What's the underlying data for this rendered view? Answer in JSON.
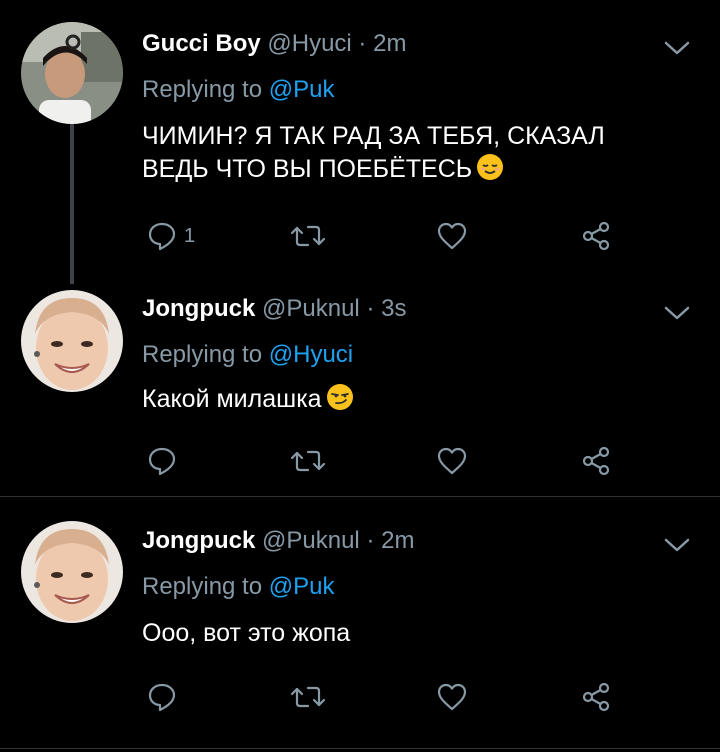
{
  "tweets": [
    {
      "name": "Gucci Boy",
      "handle": "@Hyuci",
      "dot": "·",
      "time": "2m",
      "reply_prefix": "Replying to",
      "reply_to": "@Puk",
      "text_line1": "ЧИМИН? Я ТАК РАД ЗА ТЕБЯ, СКАЗАЛ",
      "text_line2": "ВЕДЬ ЧТО ВЫ ПОЕБЁТЕСЬ",
      "reply_count": "1",
      "emoji": "relieved-face"
    },
    {
      "name": "Jongpuck",
      "handle": "@Puknul",
      "dot": "·",
      "time": "3s",
      "reply_prefix": "Replying to",
      "reply_to": "@Hyuci",
      "text": "Какой милашка",
      "reply_count": "",
      "emoji": "smirking-face"
    },
    {
      "name": "Jongpuck",
      "handle": "@Puknul",
      "dot": "·",
      "time": "2m",
      "reply_prefix": "Replying to",
      "reply_to": "@Puk",
      "text": "Ооо, вот это жопа",
      "reply_count": ""
    }
  ],
  "colors": {
    "background": "#000000",
    "secondary_text": "#8899a6",
    "mention": "#1da1f2",
    "separator": "#2f3336"
  }
}
